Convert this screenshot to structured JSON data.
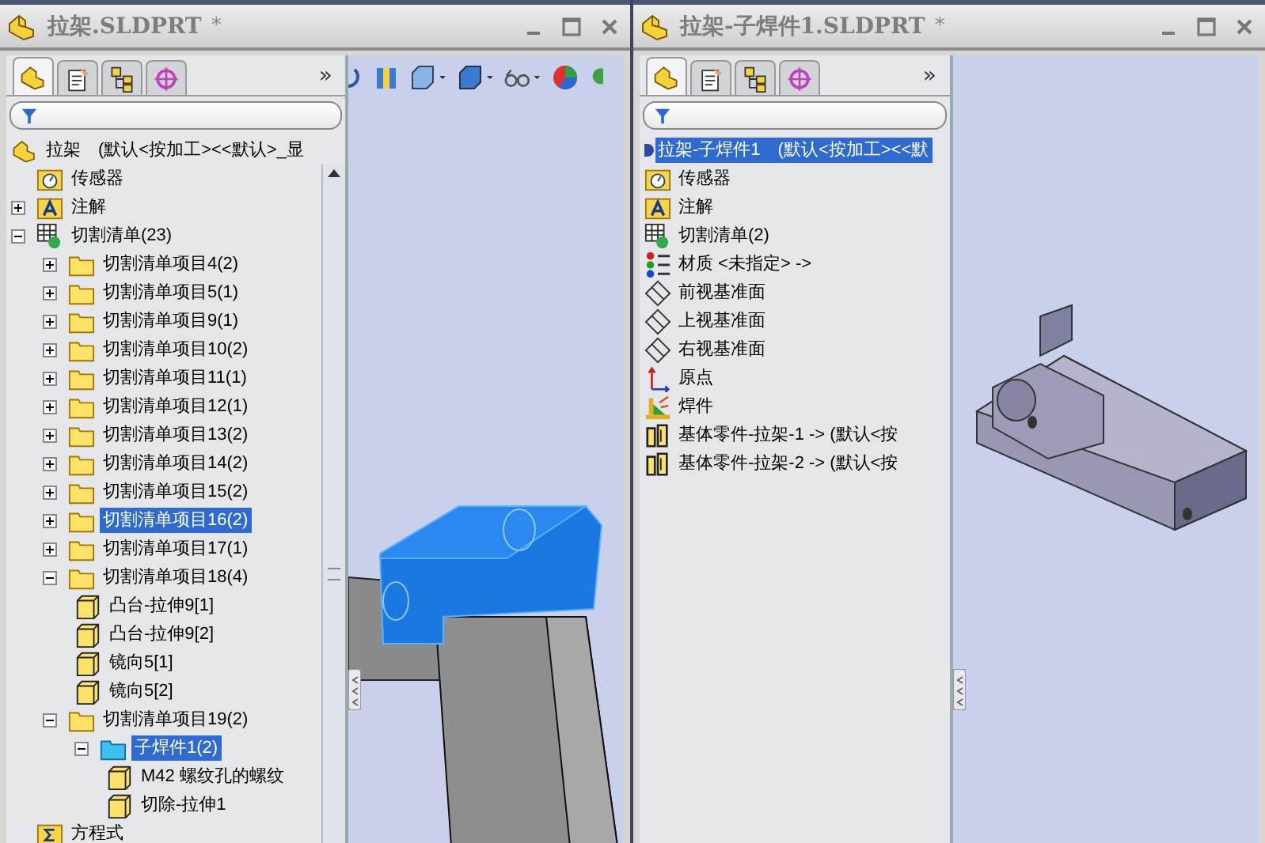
{
  "windows": [
    {
      "title": "拉架.SLDPRT",
      "modified": "*",
      "more": "»",
      "tabs": [
        {
          "kind": "feature",
          "selected": true
        },
        {
          "kind": "property",
          "selected": false
        },
        {
          "kind": "config",
          "selected": false
        },
        {
          "kind": "dimxpert",
          "selected": false
        }
      ],
      "viewport": {
        "kind": "frame"
      },
      "tree": {
        "label": "拉架　(默认<按加工><<默认>_显",
        "kind": "part",
        "selected": false,
        "children": [
          {
            "label": "传感器",
            "kind": "sensor",
            "selected": false
          },
          {
            "label": "注解",
            "kind": "annotation",
            "selected": false,
            "expanded": false
          },
          {
            "label": "切割清单(23)",
            "kind": "cutlist",
            "selected": false,
            "expanded": true,
            "children": [
              {
                "label": "切割清单项目4(2)",
                "kind": "folder",
                "selected": false,
                "expanded": false
              },
              {
                "label": "切割清单项目5(1)",
                "kind": "folder",
                "selected": false,
                "expanded": false
              },
              {
                "label": "切割清单项目9(1)",
                "kind": "folder",
                "selected": false,
                "expanded": false
              },
              {
                "label": "切割清单项目10(2)",
                "kind": "folder",
                "selected": false,
                "expanded": false
              },
              {
                "label": "切割清单项目11(1)",
                "kind": "folder",
                "selected": false,
                "expanded": false
              },
              {
                "label": "切割清单项目12(1)",
                "kind": "folder",
                "selected": false,
                "expanded": false
              },
              {
                "label": "切割清单项目13(2)",
                "kind": "folder",
                "selected": false,
                "expanded": false
              },
              {
                "label": "切割清单项目14(2)",
                "kind": "folder",
                "selected": false,
                "expanded": false
              },
              {
                "label": "切割清单项目15(2)",
                "kind": "folder",
                "selected": false,
                "expanded": false
              },
              {
                "label": "切割清单项目16(2)",
                "kind": "folder",
                "selected": true,
                "expanded": false
              },
              {
                "label": "切割清单项目17(1)",
                "kind": "folder",
                "selected": false,
                "expanded": false
              },
              {
                "label": "切割清单项目18(4)",
                "kind": "folder",
                "selected": false,
                "expanded": true,
                "children": [
                  {
                    "label": "凸台-拉伸9[1]",
                    "kind": "body",
                    "selected": false
                  },
                  {
                    "label": "凸台-拉伸9[2]",
                    "kind": "body",
                    "selected": false
                  },
                  {
                    "label": "镜向5[1]",
                    "kind": "body",
                    "selected": false
                  },
                  {
                    "label": "镜向5[2]",
                    "kind": "body",
                    "selected": false
                  }
                ]
              },
              {
                "label": "切割清单项目19(2)",
                "kind": "folder",
                "selected": false,
                "expanded": true,
                "children": [
                  {
                    "label": "子焊件1(2)",
                    "kind": "subfolder",
                    "selected": true,
                    "expanded": true,
                    "children": [
                      {
                        "label": "M42 螺纹孔的螺纹",
                        "kind": "body",
                        "selected": false
                      },
                      {
                        "label": "切除-拉伸1",
                        "kind": "body",
                        "selected": false
                      }
                    ]
                  }
                ]
              }
            ]
          },
          {
            "label": "方程式",
            "kind": "equation",
            "selected": false
          }
        ]
      }
    },
    {
      "title": "拉架-子焊件1.SLDPRT",
      "modified": "*",
      "more": "»",
      "tabs": [
        {
          "kind": "feature",
          "selected": true
        },
        {
          "kind": "property",
          "selected": false
        },
        {
          "kind": "config",
          "selected": false
        },
        {
          "kind": "dimxpert",
          "selected": false
        }
      ],
      "viewport": {
        "kind": "bracket"
      },
      "tree": {
        "label": "拉架-子焊件1　(默认<按加工><<默",
        "kind": "none",
        "selected": true,
        "children": [
          {
            "label": "传感器",
            "kind": "sensor",
            "selected": false
          },
          {
            "label": "注解",
            "kind": "annotation",
            "selected": false
          },
          {
            "label": "切割清单(2)",
            "kind": "cutlist",
            "selected": false
          },
          {
            "label": "材质 <未指定> ->",
            "kind": "material",
            "selected": false
          },
          {
            "label": "前视基准面",
            "kind": "plane",
            "selected": false
          },
          {
            "label": "上视基准面",
            "kind": "plane",
            "selected": false
          },
          {
            "label": "右视基准面",
            "kind": "plane",
            "selected": false
          },
          {
            "label": "原点",
            "kind": "origin",
            "selected": false
          },
          {
            "label": "焊件",
            "kind": "weldment",
            "selected": false
          },
          {
            "label": "基体零件-拉架-1 -> (默认<按",
            "kind": "basepart",
            "selected": false
          },
          {
            "label": "基体零件-拉架-2 -> (默认<按",
            "kind": "basepart",
            "selected": false
          }
        ]
      }
    }
  ]
}
